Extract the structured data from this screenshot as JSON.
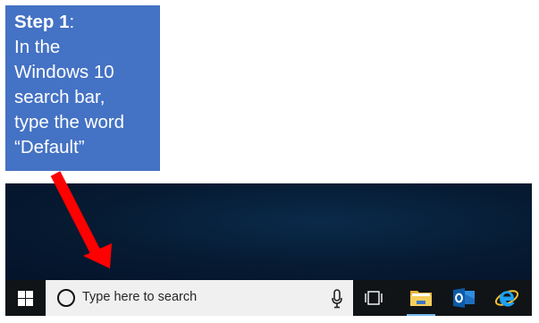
{
  "callout": {
    "step_label": "Step 1",
    "step_colon": ":",
    "lines": [
      "In the",
      "Windows 10",
      "search bar,",
      "type the word",
      "“Default”"
    ]
  },
  "taskbar": {
    "search": {
      "placeholder": "Type here to search"
    },
    "apps": [
      {
        "name": "File Explorer",
        "icon": "folder-icon",
        "running": true
      },
      {
        "name": "Outlook",
        "icon": "outlook-icon",
        "running": false
      },
      {
        "name": "Internet Explorer",
        "icon": "internet-explorer-icon",
        "running": false
      }
    ]
  },
  "colors": {
    "callout_bg": "#4472c4",
    "arrow": "#ff0000",
    "taskbar": "#111417",
    "search_box": "#f0f0f0",
    "desktop": "#061a31",
    "running_indicator": "#76b9ed"
  }
}
